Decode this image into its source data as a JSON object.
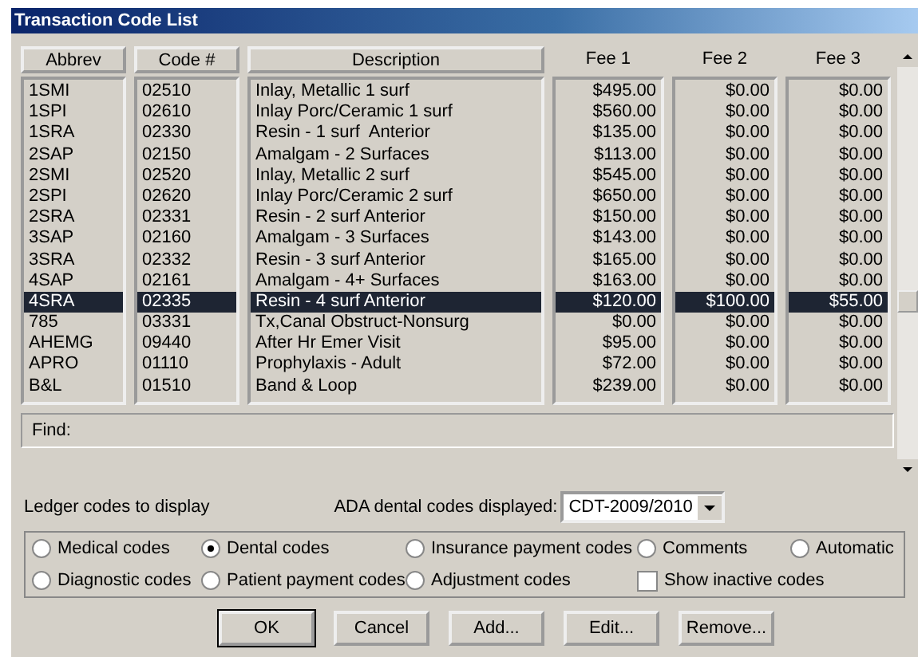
{
  "window": {
    "title": "Transaction Code List"
  },
  "columns": [
    {
      "label": "Abbrev",
      "kind": "button"
    },
    {
      "label": "Code #",
      "kind": "button"
    },
    {
      "label": "Description",
      "kind": "button"
    },
    {
      "label": "Fee 1",
      "kind": "plain"
    },
    {
      "label": "Fee 2",
      "kind": "plain"
    },
    {
      "label": "Fee 3",
      "kind": "plain"
    }
  ],
  "rows": [
    {
      "cells": [
        "1SMI",
        "02510",
        "Inlay, Metallic 1 surf",
        "$495.00",
        "$0.00",
        "$0.00"
      ],
      "selected": false
    },
    {
      "cells": [
        "1SPI",
        "02610",
        "Inlay Porc/Ceramic 1 surf",
        "$560.00",
        "$0.00",
        "$0.00"
      ],
      "selected": false
    },
    {
      "cells": [
        "1SRA",
        "02330",
        "Resin - 1 surf  Anterior",
        "$135.00",
        "$0.00",
        "$0.00"
      ],
      "selected": false
    },
    {
      "cells": [
        "2SAP",
        "02150",
        "Amalgam - 2 Surfaces",
        "$113.00",
        "$0.00",
        "$0.00"
      ],
      "selected": false
    },
    {
      "cells": [
        "2SMI",
        "02520",
        "Inlay, Metallic 2 surf",
        "$545.00",
        "$0.00",
        "$0.00"
      ],
      "selected": false
    },
    {
      "cells": [
        "2SPI",
        "02620",
        "Inlay Porc/Ceramic 2 surf",
        "$650.00",
        "$0.00",
        "$0.00"
      ],
      "selected": false
    },
    {
      "cells": [
        "2SRA",
        "02331",
        "Resin - 2 surf Anterior",
        "$150.00",
        "$0.00",
        "$0.00"
      ],
      "selected": false
    },
    {
      "cells": [
        "3SAP",
        "02160",
        "Amalgam - 3 Surfaces",
        "$143.00",
        "$0.00",
        "$0.00"
      ],
      "selected": false
    },
    {
      "cells": [
        "3SRA",
        "02332",
        "Resin - 3 surf Anterior",
        "$165.00",
        "$0.00",
        "$0.00"
      ],
      "selected": false
    },
    {
      "cells": [
        "4SAP",
        "02161",
        "Amalgam - 4+ Surfaces",
        "$163.00",
        "$0.00",
        "$0.00"
      ],
      "selected": false
    },
    {
      "cells": [
        "4SRA",
        "02335",
        "Resin - 4 surf Anterior",
        "$120.00",
        "$100.00",
        "$55.00"
      ],
      "selected": true
    },
    {
      "cells": [
        "785",
        "03331",
        "Tx,Canal Obstruct-Nonsurg",
        "$0.00",
        "$0.00",
        "$0.00"
      ],
      "selected": false
    },
    {
      "cells": [
        "AHEMG",
        "09440",
        "After Hr Emer Visit",
        "$95.00",
        "$0.00",
        "$0.00"
      ],
      "selected": false
    },
    {
      "cells": [
        "APRO",
        "01110",
        "Prophylaxis - Adult",
        "$72.00",
        "$0.00",
        "$0.00"
      ],
      "selected": false
    },
    {
      "cells": [
        "B&L",
        "01510",
        "Band & Loop",
        "$239.00",
        "$0.00",
        "$0.00"
      ],
      "selected": false
    }
  ],
  "find": {
    "label": "Find:"
  },
  "ledger_label": "Ledger codes to display",
  "ada": {
    "label": "ADA dental codes displayed:",
    "value": "CDT-2009/2010"
  },
  "options": [
    {
      "kind": "radio",
      "label": "Medical codes",
      "checked": false
    },
    {
      "kind": "radio",
      "label": "Dental codes",
      "checked": true
    },
    {
      "kind": "radio",
      "label": "Insurance payment codes",
      "checked": false
    },
    {
      "kind": "radio",
      "label": "Comments",
      "checked": false
    },
    {
      "kind": "radio",
      "label": "Automatic",
      "checked": false
    },
    {
      "kind": "radio",
      "label": "Diagnostic codes",
      "checked": false
    },
    {
      "kind": "radio",
      "label": "Patient payment codes",
      "checked": false
    },
    {
      "kind": "radio",
      "label": "Adjustment codes",
      "checked": false
    },
    {
      "kind": "checkbox",
      "label": "Show inactive codes",
      "checked": false
    }
  ],
  "buttons": [
    "OK",
    "Cancel",
    "Add...",
    "Edit...",
    "Remove..."
  ]
}
